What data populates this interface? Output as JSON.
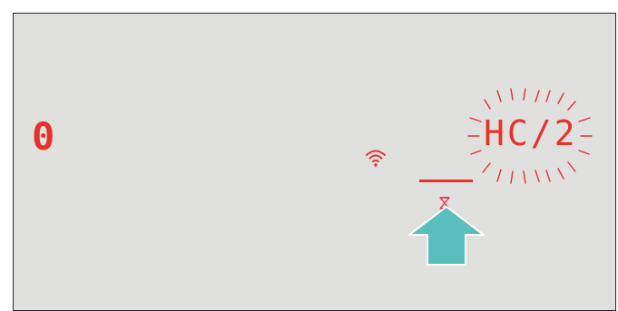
{
  "display": {
    "left_value": "0",
    "mode_code": "HC/2",
    "mode_code_state": "flashing"
  },
  "icons": {
    "wifi": "wifi-icon",
    "timer": "hourglass-icon",
    "pointer": "up-arrow-icon"
  },
  "colors": {
    "panel_background": "#e0e0df",
    "segment_red": "#e8312b",
    "arrow_teal": "#5bbfbf"
  }
}
